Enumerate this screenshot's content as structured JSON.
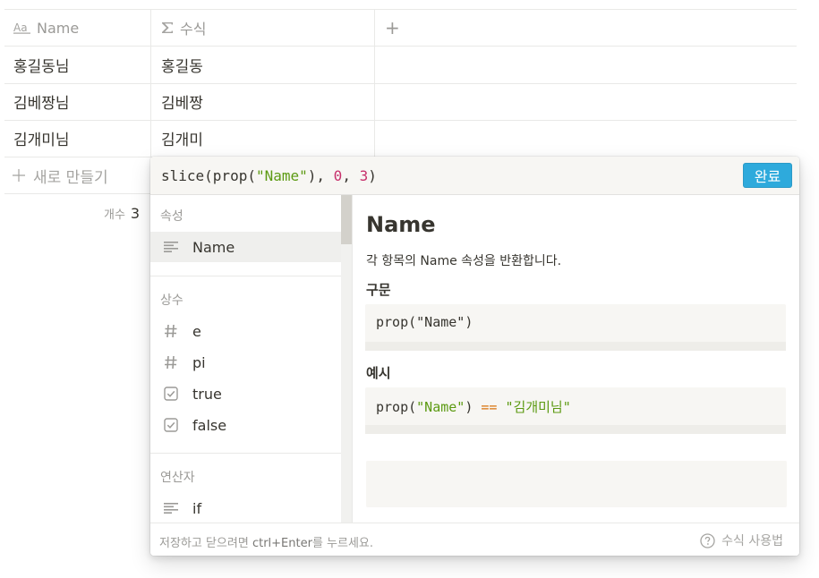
{
  "table": {
    "columns": [
      {
        "icon": "text-type-icon",
        "label": "Name"
      },
      {
        "icon": "sigma-icon",
        "label": "수식"
      }
    ],
    "add_column_label": "+",
    "rows": [
      {
        "name": "홍길동님",
        "formula": "홍길동"
      },
      {
        "name": "김베짱님",
        "formula": "김베짱"
      },
      {
        "name": "김개미님",
        "formula": "김개미"
      }
    ],
    "new_row_label": "새로 만들기",
    "count_label": "개수",
    "count_value": "3"
  },
  "formula_editor": {
    "tokens": {
      "fn": "slice(prop(",
      "str": "\"Name\"",
      "sep1": "), ",
      "num1": "0",
      "sep2": ", ",
      "num2": "3",
      "close": ")"
    },
    "done_label": "완료",
    "sections": {
      "properties": {
        "label": "속성",
        "items": [
          {
            "label": "Name",
            "icon": "text-lines-icon",
            "selected": true
          }
        ]
      },
      "constants": {
        "label": "상수",
        "items": [
          {
            "label": "e",
            "icon": "hash-icon"
          },
          {
            "label": "pi",
            "icon": "hash-icon"
          },
          {
            "label": "true",
            "icon": "checkbox-icon"
          },
          {
            "label": "false",
            "icon": "checkbox-icon"
          }
        ]
      },
      "operators": {
        "label": "연산자",
        "items": [
          {
            "label": "if",
            "icon": "text-lines-icon"
          }
        ]
      }
    },
    "doc": {
      "title": "Name",
      "description": "각 항목의 Name 속성을 반환합니다.",
      "syntax_heading": "구문",
      "syntax_code": {
        "a": "prop(\"Name\")"
      },
      "example_heading": "예시",
      "example_code": {
        "a": "prop(",
        "b": "\"Name\"",
        "c": ") ",
        "d": "==",
        "e": " ",
        "f": "\"김개미님\""
      }
    },
    "footer": {
      "hint_before": "저장하고 닫으려면 ",
      "hint_key": "ctrl+Enter",
      "hint_after": "를 누르세요.",
      "help_label": "수식 사용법"
    }
  }
}
